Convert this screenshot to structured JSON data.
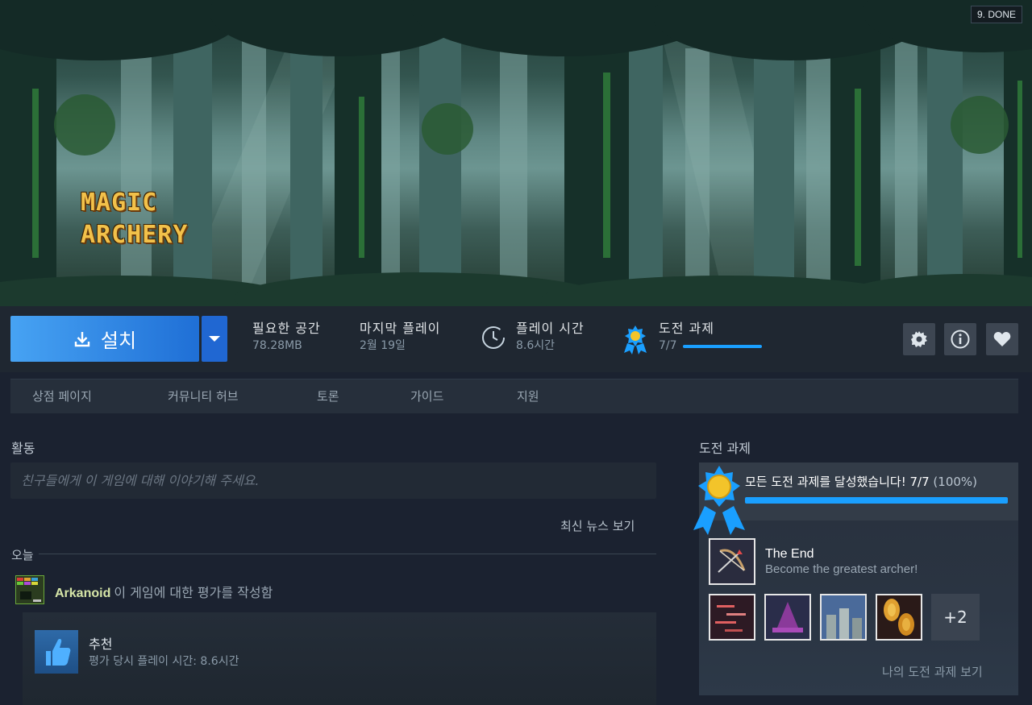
{
  "hero": {
    "logo_line1": "MAGIC",
    "logo_line2": "ARCHERY",
    "step_badge": "9. DONE"
  },
  "action_bar": {
    "install_label": "설치",
    "install_icon": "download-icon",
    "dropdown_icon": "caret-down-icon",
    "stats": {
      "space": {
        "title": "필요한 공간",
        "value": "78.28MB"
      },
      "last_played": {
        "title": "마지막 플레이",
        "value": "2월 19일"
      },
      "playtime": {
        "title": "플레이 시간",
        "value": "8.6시간",
        "icon": "clock-icon"
      },
      "achievements": {
        "title": "도전 과제",
        "value": "7/7",
        "progress": 1.0,
        "icon": "medal-icon"
      }
    },
    "icons": [
      "gear-icon",
      "info-icon",
      "heart-icon"
    ]
  },
  "nav": {
    "items": [
      "상점 페이지",
      "커뮤니티 허브",
      "토론",
      "가이드",
      "지원"
    ]
  },
  "activity": {
    "title": "활동",
    "comment_placeholder": "친구들에게 이 게임에 대해 이야기해 주세요.",
    "news_link": "최신 뉴스 보기",
    "today_label": "오늘",
    "entry": {
      "game": "Arkanoid",
      "action": "이 게임에 대한 평가를 작성함",
      "review_title": "추천",
      "review_sub": "평가 당시 플레이 시간: 8.6시간"
    }
  },
  "achievements": {
    "title": "도전 과제",
    "all_done_text": "모든 도전 과제를 달성했습니다! 7/7",
    "all_done_pct": "(100%)",
    "progress": 1.0,
    "featured": {
      "name": "The End",
      "description": "Become the greatest archer!"
    },
    "more_count": "+2",
    "view_link": "나의 도전 과제 보기"
  },
  "colors": {
    "accent": "#1a9fff",
    "install_start": "#47a3f3",
    "install_end": "#1f6fd6",
    "background": "#1b2230"
  }
}
